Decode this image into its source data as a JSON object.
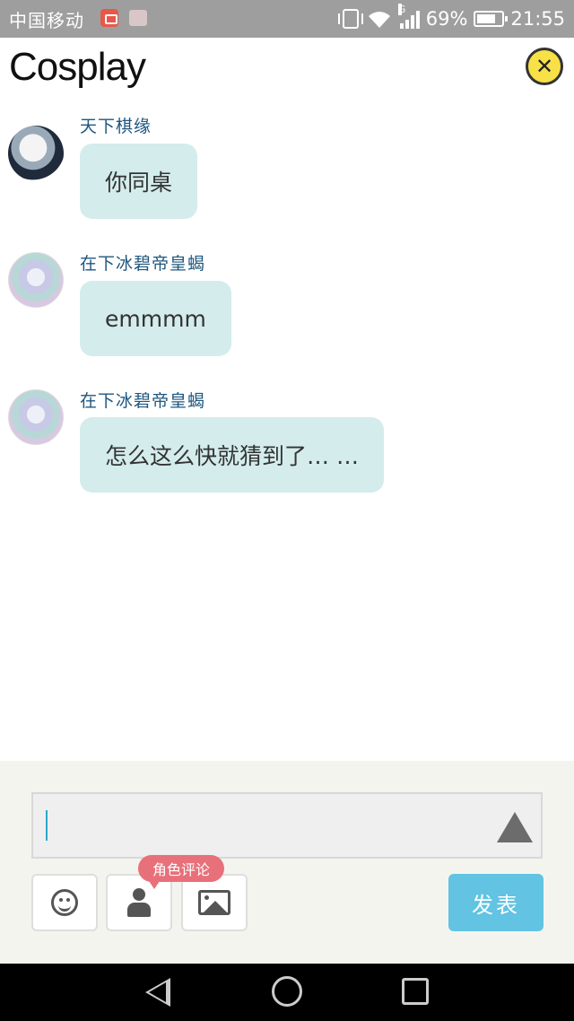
{
  "status_bar": {
    "carrier": "中国移动",
    "network_type": "G",
    "battery": "69%",
    "time": "21:55"
  },
  "header": {
    "title": "Cosplay",
    "close_icon": "close-circle-icon",
    "close_glyph": "✕",
    "accent_color": "#f8e047"
  },
  "messages": [
    {
      "sender": "天下棋缘",
      "text": "你同桌"
    },
    {
      "sender": "在下冰碧帝皇蝎",
      "text": "emmmm"
    },
    {
      "sender": "在下冰碧帝皇蝎",
      "text": "怎么这么快就猜到了… …"
    }
  ],
  "composer": {
    "input_value": "",
    "role_tooltip": "角色评论",
    "send_label": "发表",
    "send_color": "#62c3e2",
    "icons": [
      "emoji-icon",
      "person-icon",
      "image-icon",
      "expand-icon"
    ]
  },
  "nav_bar": {
    "icons": [
      "back-icon",
      "home-icon",
      "recent-apps-icon"
    ]
  }
}
